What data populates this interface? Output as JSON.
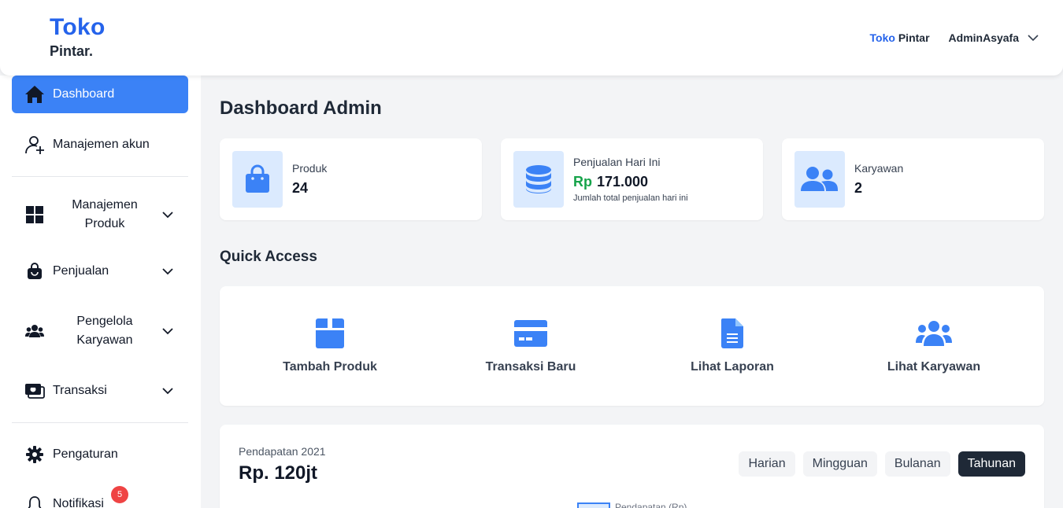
{
  "header": {
    "brand_top": "Toko",
    "brand_bottom": "Pintar.",
    "right_brand_1": "Toko",
    "right_brand_2": "Pintar",
    "username": "AdminAsyafa"
  },
  "sidebar": {
    "items": [
      {
        "label": "Dashboard",
        "icon": "home-icon"
      },
      {
        "label": "Manajemen akun",
        "icon": "user-plus-icon"
      },
      {
        "label": "Manajemen Produk",
        "icon": "grid-icon"
      },
      {
        "label": "Penjualan",
        "icon": "shopping-bag-icon"
      },
      {
        "label": "Pengelola Karyawan",
        "icon": "users-icon"
      },
      {
        "label": "Transaksi",
        "icon": "money-icon"
      },
      {
        "label": "Pengaturan",
        "icon": "gear-icon"
      },
      {
        "label": "Notifikasi",
        "icon": "bell-icon",
        "badge": "5"
      }
    ]
  },
  "main": {
    "title": "Dashboard Admin",
    "stats": [
      {
        "label": "Produk",
        "value": "24",
        "icon": "bag-icon"
      },
      {
        "label": "Penjualan Hari Ini",
        "currency": "Rp",
        "value": "171.000",
        "sub": "Jumlah total penjualan hari ini",
        "icon": "database-icon"
      },
      {
        "label": "Karyawan",
        "value": "2",
        "icon": "users-icon"
      }
    ],
    "quick_access": {
      "title": "Quick Access",
      "items": [
        {
          "label": "Tambah Produk",
          "icon": "box-icon"
        },
        {
          "label": "Transaksi Baru",
          "icon": "credit-card-icon"
        },
        {
          "label": "Lihat Laporan",
          "icon": "document-icon"
        },
        {
          "label": "Lihat Karyawan",
          "icon": "users-icon"
        }
      ]
    },
    "revenue": {
      "label": "Pendapatan 2021",
      "value": "Rp. 120jt",
      "tabs": [
        "Harian",
        "Mingguan",
        "Bulanan",
        "Tahunan"
      ],
      "active_tab": "Tahunan",
      "legend": "Pendapatan (Rp)"
    }
  },
  "colors": {
    "primary": "#3b82f6",
    "brand": "#2563eb",
    "icon_bg": "#dbeafe",
    "success": "#16a34a",
    "danger": "#ef4444",
    "dark": "#1f2937"
  }
}
